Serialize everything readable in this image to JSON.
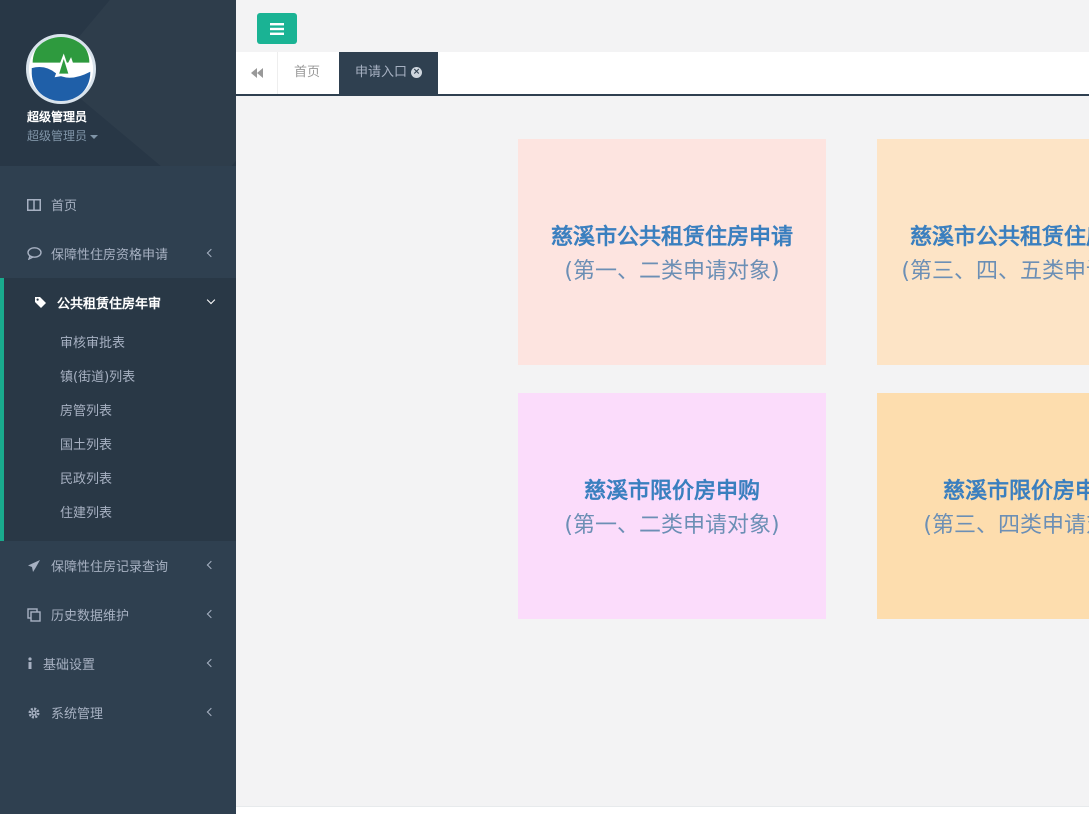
{
  "user": {
    "name": "超级管理员",
    "role": "超级管理员"
  },
  "menu": {
    "items": [
      {
        "label": "首页",
        "icon": "columns-icon"
      },
      {
        "label": "保障性住房资格申请",
        "icon": "comment-icon"
      }
    ],
    "active_group": {
      "label": "公共租赁住房年审",
      "icon": "tag-icon",
      "sub_items": [
        "审核审批表",
        "镇(街道)列表",
        "房管列表",
        "国土列表",
        "民政列表",
        "住建列表"
      ]
    },
    "items_after": [
      {
        "label": "保障性住房记录查询",
        "icon": "paper-plane-icon"
      },
      {
        "label": "历史数据维护",
        "icon": "copy-icon"
      },
      {
        "label": "基础设置",
        "icon": "info-icon"
      },
      {
        "label": "系统管理",
        "icon": "gear-icon"
      }
    ]
  },
  "tabs": {
    "home": "首页",
    "active": "申请入口"
  },
  "cards": [
    {
      "title": "慈溪市公共租赁住房申请",
      "subtitle": "(第一、二类申请对象)",
      "color": "#fde4e0"
    },
    {
      "title": "慈溪市公共租赁住房申请",
      "subtitle": "(第三、四、五类申请对象)",
      "color": "#fde4c6"
    },
    {
      "title": "慈溪市限价房申购",
      "subtitle": "(第一、二类申请对象)",
      "color": "#fbdcfb"
    },
    {
      "title": "慈溪市限价房申购",
      "subtitle": "(第三、四类申请对象)",
      "color": "#fdddae"
    }
  ],
  "colors": {
    "sidebar": "#2f4050",
    "accent": "#1ab394",
    "card_title": "#3a7fbf"
  }
}
